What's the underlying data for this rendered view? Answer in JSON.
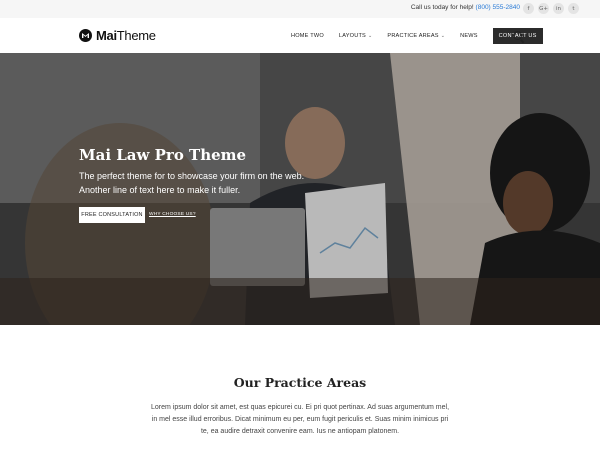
{
  "topbar": {
    "help_text": "Call us today for help!",
    "phone": "(800) 555-2840",
    "social": [
      {
        "icon": "facebook-icon",
        "glyph": "f"
      },
      {
        "icon": "google-plus-icon",
        "glyph": "G+"
      },
      {
        "icon": "linkedin-icon",
        "glyph": "in"
      },
      {
        "icon": "twitter-icon",
        "glyph": "t"
      }
    ]
  },
  "header": {
    "logo_bold": "Mai",
    "logo_light": "Theme",
    "nav": [
      {
        "label": "HOME TWO",
        "dropdown": false
      },
      {
        "label": "LAYOUTS",
        "dropdown": true
      },
      {
        "label": "PRACTICE AREAS",
        "dropdown": true
      },
      {
        "label": "NEWS",
        "dropdown": false
      }
    ],
    "contact_label": "CONTACT US"
  },
  "hero": {
    "title": "Mai Law Pro Theme",
    "subtitle_line1": "The perfect theme for to showcase your firm on the web.",
    "subtitle_line2": "Another line of text here to make it fuller.",
    "primary_button": "FREE CONSULTATION",
    "secondary_link": "WHY CHOOSE US?"
  },
  "practice": {
    "title": "Our Practice Areas",
    "body": "Lorem ipsum dolor sit amet, est quas epicurei cu. Ei pri quot pertinax. Ad suas argumentum mel, in mel esse illud erroribus. Dicat minimum eu per, eum fugit periculis et. Suas minim inimicus pri te, ea audire detraxit convenire eam. Ius ne antiopam platonem."
  }
}
